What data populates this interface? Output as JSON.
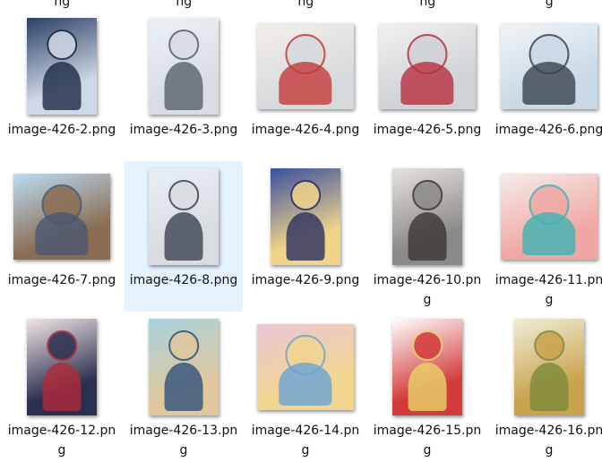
{
  "top_row_fragments": [
    "ng",
    "ng",
    "ng",
    "ng",
    "g"
  ],
  "files": [
    {
      "name": "image-426-2.png",
      "selected": false,
      "colors": [
        "#2b3f66",
        "#cfd8e6",
        "#1c2a44"
      ],
      "portrait": true
    },
    {
      "name": "image-426-3.png",
      "selected": false,
      "colors": [
        "#eaf1f6",
        "#d8dde3",
        "#58606a"
      ],
      "portrait": true
    },
    {
      "name": "image-426-4.png",
      "selected": false,
      "colors": [
        "#f4eee9",
        "#d7dadd",
        "#c53a3a"
      ],
      "portrait": false
    },
    {
      "name": "image-426-5.png",
      "selected": false,
      "colors": [
        "#f3f1f1",
        "#cfd2d6",
        "#b72f3f"
      ],
      "portrait": false
    },
    {
      "name": "image-426-6.png",
      "selected": false,
      "colors": [
        "#f1f4f6",
        "#c9d9e6",
        "#3a4250"
      ],
      "portrait": false
    },
    {
      "name": "image-426-7.png",
      "selected": false,
      "colors": [
        "#bcdcf2",
        "#8a6c52",
        "#4a5870"
      ],
      "portrait": false
    },
    {
      "name": "image-426-8.png",
      "selected": true,
      "colors": [
        "#e6eef5",
        "#d9dde1",
        "#3c4450"
      ],
      "portrait": true
    },
    {
      "name": "image-426-9.png",
      "selected": false,
      "colors": [
        "#3a4fa0",
        "#f1d48a",
        "#2c3060"
      ],
      "portrait": true
    },
    {
      "name": "image-426-10.png",
      "selected": false,
      "colors": [
        "#e6e3df",
        "#8c8a88",
        "#3a3634"
      ],
      "portrait": true
    },
    {
      "name": "image-426-11.png",
      "selected": false,
      "colors": [
        "#f6ecea",
        "#f0a7a3",
        "#3fb3b3"
      ],
      "portrait": false
    },
    {
      "name": "image-426-12.png",
      "selected": false,
      "colors": [
        "#f3e6e8",
        "#2b2f4f",
        "#b02a3a"
      ],
      "portrait": true
    },
    {
      "name": "image-426-13.png",
      "selected": false,
      "colors": [
        "#a9d2df",
        "#e0c89c",
        "#30507a"
      ],
      "portrait": true
    },
    {
      "name": "image-426-14.png",
      "selected": false,
      "colors": [
        "#e9c7d6",
        "#f2d58e",
        "#6aa3d6"
      ],
      "portrait": false
    },
    {
      "name": "image-426-15.png",
      "selected": false,
      "colors": [
        "#ffffff",
        "#d33a3a",
        "#e8d36c"
      ],
      "portrait": true
    },
    {
      "name": "image-426-16.png",
      "selected": false,
      "colors": [
        "#f0eed7",
        "#c9a24c",
        "#7a8a3a"
      ],
      "portrait": true
    }
  ]
}
